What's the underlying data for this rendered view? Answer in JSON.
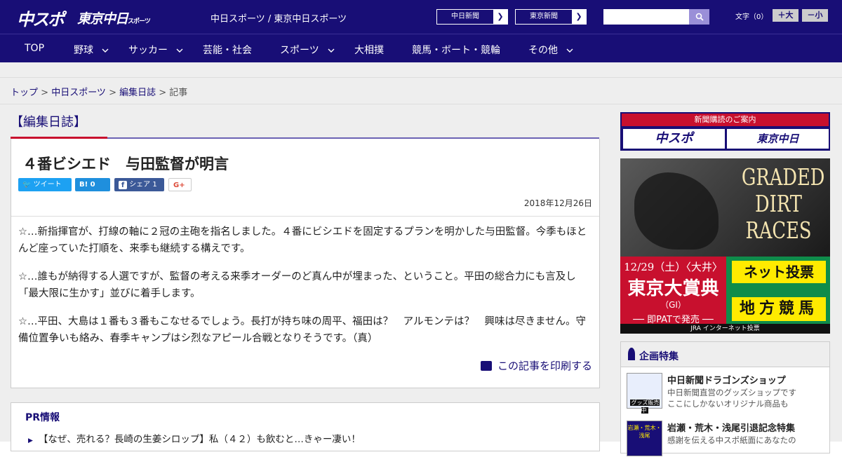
{
  "header": {
    "logo_chuspo": "中スポ",
    "logo_tokyo": "東京中日",
    "logo_tokyo_small": "スポーツ",
    "site_names": "中日スポーツ / 東京中日スポーツ",
    "paper_links": [
      "中日新聞",
      "東京新聞"
    ],
    "search_placeholder": "",
    "font_label": "文字（0）",
    "font_bigger": "＋大",
    "font_smaller": "－小"
  },
  "nav": {
    "items": [
      {
        "label": "TOP",
        "dropdown": false
      },
      {
        "label": "野球",
        "dropdown": true
      },
      {
        "label": "サッカー",
        "dropdown": true
      },
      {
        "label": "芸能・社会",
        "dropdown": false
      },
      {
        "label": "スポーツ",
        "dropdown": true
      },
      {
        "label": "大相撲",
        "dropdown": false
      },
      {
        "label": "競馬・ボート・競輪",
        "dropdown": false
      },
      {
        "label": "その他",
        "dropdown": true
      }
    ]
  },
  "breadcrumb": {
    "items": [
      "トップ",
      "中日スポーツ",
      "編集日誌"
    ],
    "current": "記事",
    "sep": " > "
  },
  "section": {
    "title": "【編集日誌】"
  },
  "article": {
    "headline": "４番ビシエド　与田監督が明言",
    "share": {
      "tweet": "ツイート",
      "hatena": "B! 0",
      "facebook": "シェア 1",
      "gplus": "G+"
    },
    "date": "2018年12月26日",
    "paragraphs": [
      "☆…新指揮官が、打線の軸に２冠の主砲を指名しました。４番にビシエドを固定するプランを明かした与田監督。今季もほとんど座っていた打順を、来季も継続する構えです。",
      "☆…誰もが納得する人選ですが、監督の考える来季オーダーのど真ん中が埋まった、ということ。平田の総合力にも言及し「最大限に生かす」並びに着手します。",
      "☆…平田、大島は１番も３番もこなせるでしょう。長打が持ち味の周平、福田は？　アルモンテは？　興味は尽きません。守備位置争いも絡み、春季キャンプはシ烈なアピール合戦となりそうです。（真）"
    ],
    "print_label": "この記事を印刷する"
  },
  "pr": {
    "heading": "PR情報",
    "items": [
      "【なぜ、売れる？長崎の生姜シロップ】私（４２）も飲むと…きゃー凄い！"
    ]
  },
  "sidebar": {
    "subscribe": {
      "top": "新聞購読のご案内",
      "logo1": "中スポ",
      "logo2": "東京中日"
    },
    "ad": {
      "title": "GRADED DIRT RACES",
      "date": "12/29（土）〈大井〉",
      "race": "東京大賞典",
      "grade": "（GI）",
      "pat": "── 即PATで発売 ──",
      "net": "ネット投票",
      "chiho": "地方競馬",
      "bottom": "JRA インターネット投票"
    },
    "kikaku": {
      "heading": "企画特集",
      "items": [
        {
          "title": "中日新聞ドラゴンズショップ",
          "desc": "中日新聞直営のグッズショップです\nここにしかないオリジナル商品も",
          "img": "グッズ販売中"
        },
        {
          "title": "岩瀬・荒木・浅尾引退記念特集",
          "desc": "感謝を伝える中スポ紙面にあなたの",
          "img": "岩瀬・荒木・浅尾"
        }
      ]
    }
  }
}
